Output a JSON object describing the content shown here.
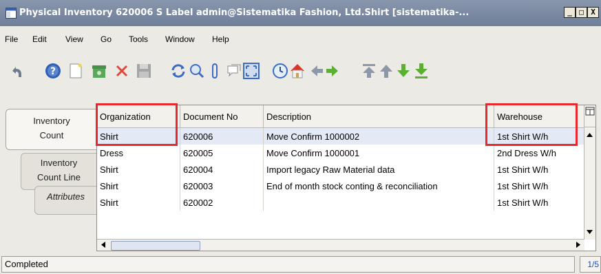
{
  "window": {
    "title": "Physical Inventory  620006  S Label  admin@Sistematika Fashion, Ltd.Shirt [sistematika-...",
    "minimize": "_",
    "maximize": "□",
    "close": "X"
  },
  "menu": {
    "file": "File",
    "edit": "Edit",
    "view": "View",
    "go": "Go",
    "tools": "Tools",
    "window": "Window",
    "help": "Help"
  },
  "toolbar": {
    "icons": [
      "undo-icon",
      "help-icon",
      "new-record-icon",
      "archive-icon",
      "delete-icon",
      "save-icon",
      "refresh-icon",
      "find-icon",
      "attachment-icon",
      "chat-icon",
      "fullscreen-icon",
      "history-icon",
      "home-icon",
      "back-icon",
      "forward-icon",
      "first-record-icon",
      "previous-record-icon",
      "next-record-icon",
      "last-record-icon"
    ]
  },
  "tabs": [
    {
      "line1": "Inventory",
      "line2": "Count"
    },
    {
      "line1": "Inventory",
      "line2": "Count Line"
    },
    {
      "line1": "Attributes"
    }
  ],
  "grid": {
    "headers": [
      "Organization",
      "Document No",
      "Description",
      "Warehouse"
    ],
    "rows": [
      {
        "org": "Shirt",
        "doc": "620006",
        "desc": "Move Confirm 1000002",
        "wh": "1st Shirt W/h"
      },
      {
        "org": "Dress",
        "doc": "620005",
        "desc": "Move Confirm 1000001",
        "wh": "2nd Dress W/h"
      },
      {
        "org": "Shirt",
        "doc": "620004",
        "desc": "Import legacy Raw Material data",
        "wh": "1st Shirt W/h"
      },
      {
        "org": "Shirt",
        "doc": "620003",
        "desc": "End of month stock conting & reconciliation",
        "wh": "1st Shirt W/h"
      },
      {
        "org": "Shirt",
        "doc": "620002",
        "desc": "",
        "wh": "1st Shirt W/h"
      }
    ]
  },
  "status": {
    "text": "Completed",
    "count": "1/5"
  },
  "colors": {
    "highlight": "#e8282d",
    "title_bg": "#7b8ba4",
    "selected_row": "#e4eaf5"
  }
}
